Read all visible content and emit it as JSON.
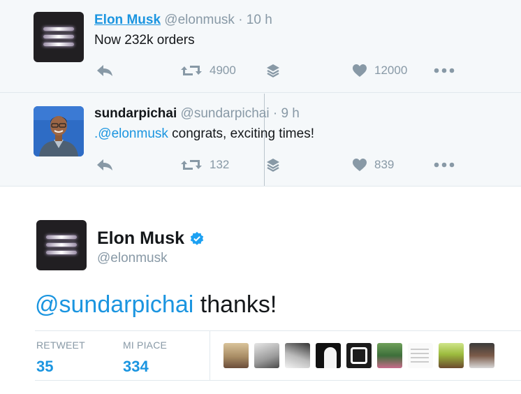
{
  "tweets": [
    {
      "name": "Elon Musk",
      "handle": "@elonmusk",
      "time": "· 10 h",
      "text": "Now 232k orders",
      "retweets": "4900",
      "likes": "12000"
    },
    {
      "name": "sundarpichai",
      "handle": "@sundarpichai",
      "time": "· 9 h",
      "mention": ".@elonmusk",
      "text": " congrats, exciting times!",
      "retweets": "132",
      "likes": "839"
    }
  ],
  "main_tweet": {
    "name": "Elon Musk",
    "handle": "@elonmusk",
    "mention": "@sundarpichai",
    "text": " thanks!",
    "retweet_label": "RETWEET",
    "retweet_count": "35",
    "like_label": "MI PIACE",
    "like_count": "334"
  },
  "icons": {
    "reply": "reply-icon",
    "retweet": "retweet-icon",
    "stack": "layers-icon",
    "like": "heart-icon",
    "more": "more-icon",
    "verified": "verified-badge-icon"
  },
  "colors": {
    "link": "#1b95e0",
    "muted": "#8899a6",
    "background": "#f5f8fa",
    "verified": "#1da1f2"
  }
}
